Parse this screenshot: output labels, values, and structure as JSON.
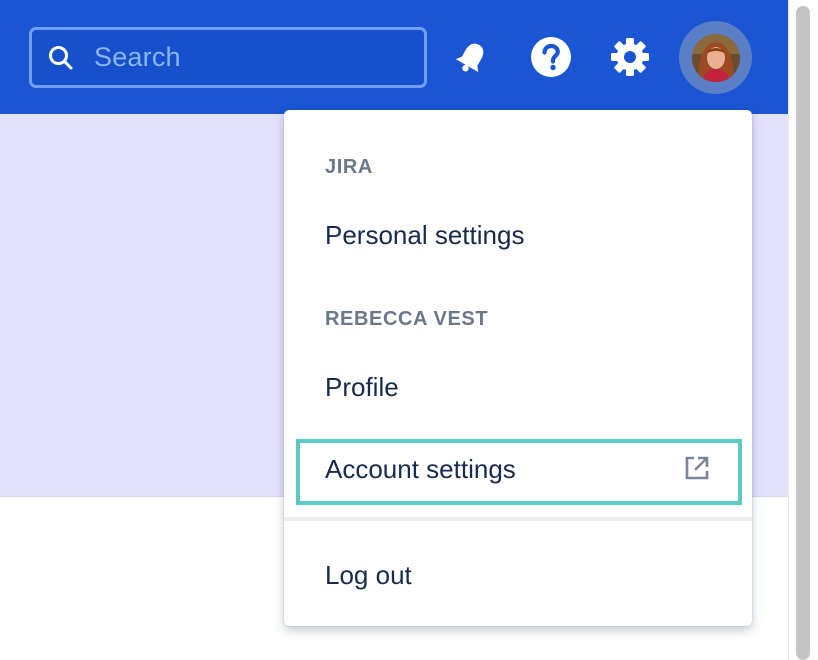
{
  "header": {
    "search": {
      "placeholder": "Search"
    },
    "icons": [
      "search-icon",
      "notifications-bell-icon",
      "help-icon",
      "settings-gear-icon",
      "user-avatar"
    ]
  },
  "dropdown": {
    "sections": [
      {
        "heading": "JIRA",
        "items": [
          {
            "label": "Personal settings"
          }
        ]
      },
      {
        "heading": "REBECCA VEST",
        "items": [
          {
            "label": "Profile"
          },
          {
            "label": "Account settings",
            "icon": "external-link-icon",
            "focused": true
          }
        ]
      }
    ],
    "logout_label": "Log out"
  },
  "colors": {
    "header_bg": "#1a56d3",
    "page_banner": "#e4e1fd",
    "focus_ring": "#5bc9c6",
    "heading_text": "#6b778c",
    "menu_text": "#172b4d"
  }
}
